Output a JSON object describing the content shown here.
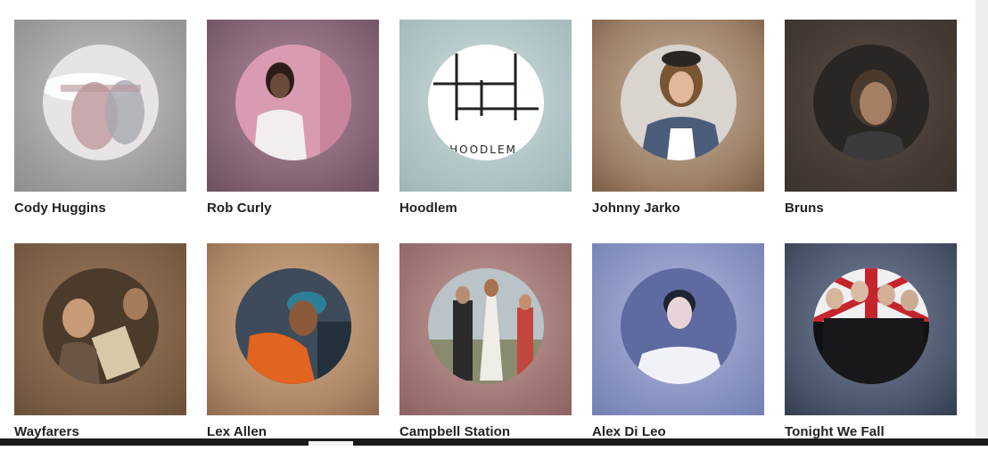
{
  "artists": [
    {
      "name": "Cody Huggins",
      "colors": {
        "bg": "#a9a7a8",
        "circle": "#d9d4d6"
      }
    },
    {
      "name": "Rob Curly",
      "colors": {
        "bg": "#8f6f80",
        "circle": "#d89fb3"
      }
    },
    {
      "name": "Hoodlem",
      "colors": {
        "bg": "#b3c7c8",
        "circle": "#ffffff"
      },
      "logo_text": "HOODLEM"
    },
    {
      "name": "Johnny Jarko",
      "colors": {
        "bg": "#a08770",
        "circle": "#6a5a4a"
      }
    },
    {
      "name": "Bruns",
      "colors": {
        "bg": "#4a4038",
        "circle": "#2e2a26"
      }
    },
    {
      "name": "Wayfarers",
      "colors": {
        "bg": "#8d6d52",
        "circle": "#5a4432"
      }
    },
    {
      "name": "Lex Allen",
      "colors": {
        "bg": "#b89274",
        "circle": "#c8602a"
      }
    },
    {
      "name": "Campbell Station",
      "colors": {
        "bg": "#a87c7a",
        "circle": "#9aa3a0"
      }
    },
    {
      "name": "Alex Di Leo",
      "colors": {
        "bg": "#8890bb",
        "circle": "#6d79a8"
      }
    },
    {
      "name": "Tonight We Fall",
      "colors": {
        "bg": "#4a5468",
        "circle": "#1c1c1f"
      }
    }
  ]
}
